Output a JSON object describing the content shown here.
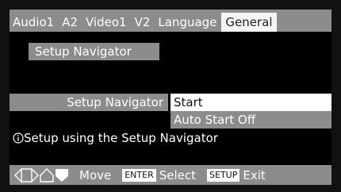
{
  "tabs": [
    {
      "label": "Audio1"
    },
    {
      "label": "A2"
    },
    {
      "label": "Video1"
    },
    {
      "label": "V2"
    },
    {
      "label": "Language"
    },
    {
      "label": "General",
      "active": true
    }
  ],
  "menu_item": "Setup Navigator",
  "setting": {
    "label": "Setup Navigator",
    "options": [
      {
        "label": "Start",
        "selected": true
      },
      {
        "label": "Auto Start Off",
        "selected": false
      }
    ]
  },
  "info": {
    "icon": "info-icon",
    "text": "Setup using the Setup Navigator"
  },
  "bottom_bar": {
    "move_label": "Move",
    "enter_key": "ENTER",
    "select_label": "Select",
    "setup_key": "SETUP",
    "exit_label": "Exit"
  },
  "colors": {
    "background": "#000000",
    "panel_gray": "#8c8c8c",
    "highlight": "#ffffff"
  }
}
